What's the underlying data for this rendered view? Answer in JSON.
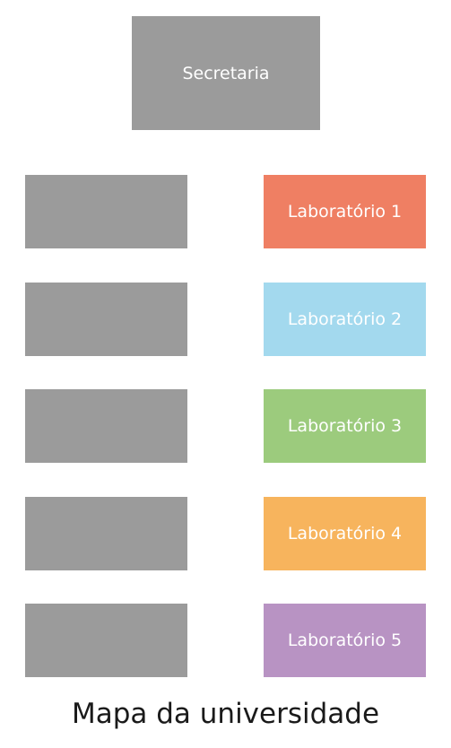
{
  "map": {
    "title": "Mapa da universidade",
    "secretaria": {
      "label": "Secretaria",
      "color": "#9b9b9b"
    },
    "unlabeled_rooms": {
      "color": "#9b9b9b",
      "count": 5
    },
    "labs": [
      {
        "label": "Laboratório 1",
        "color": "#ef7f63"
      },
      {
        "label": "Laboratório 2",
        "color": "#a3d9ee"
      },
      {
        "label": "Laboratório 3",
        "color": "#9ccb7d"
      },
      {
        "label": "Laboratório 4",
        "color": "#f7b45d"
      },
      {
        "label": "Laboratório 5",
        "color": "#b893c3"
      }
    ]
  }
}
